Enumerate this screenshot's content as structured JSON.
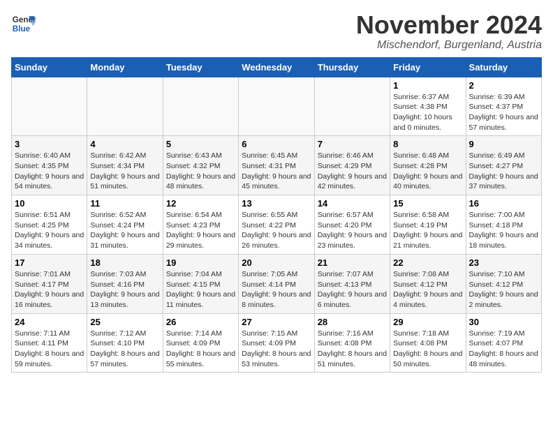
{
  "header": {
    "logo_line1": "General",
    "logo_line2": "Blue",
    "main_title": "November 2024",
    "subtitle": "Mischendorf, Burgenland, Austria"
  },
  "days_of_week": [
    "Sunday",
    "Monday",
    "Tuesday",
    "Wednesday",
    "Thursday",
    "Friday",
    "Saturday"
  ],
  "weeks": [
    [
      {
        "day": "",
        "detail": ""
      },
      {
        "day": "",
        "detail": ""
      },
      {
        "day": "",
        "detail": ""
      },
      {
        "day": "",
        "detail": ""
      },
      {
        "day": "",
        "detail": ""
      },
      {
        "day": "1",
        "detail": "Sunrise: 6:37 AM\nSunset: 4:38 PM\nDaylight: 10 hours and 0 minutes."
      },
      {
        "day": "2",
        "detail": "Sunrise: 6:39 AM\nSunset: 4:37 PM\nDaylight: 9 hours and 57 minutes."
      }
    ],
    [
      {
        "day": "3",
        "detail": "Sunrise: 6:40 AM\nSunset: 4:35 PM\nDaylight: 9 hours and 54 minutes."
      },
      {
        "day": "4",
        "detail": "Sunrise: 6:42 AM\nSunset: 4:34 PM\nDaylight: 9 hours and 51 minutes."
      },
      {
        "day": "5",
        "detail": "Sunrise: 6:43 AM\nSunset: 4:32 PM\nDaylight: 9 hours and 48 minutes."
      },
      {
        "day": "6",
        "detail": "Sunrise: 6:45 AM\nSunset: 4:31 PM\nDaylight: 9 hours and 45 minutes."
      },
      {
        "day": "7",
        "detail": "Sunrise: 6:46 AM\nSunset: 4:29 PM\nDaylight: 9 hours and 42 minutes."
      },
      {
        "day": "8",
        "detail": "Sunrise: 6:48 AM\nSunset: 4:28 PM\nDaylight: 9 hours and 40 minutes."
      },
      {
        "day": "9",
        "detail": "Sunrise: 6:49 AM\nSunset: 4:27 PM\nDaylight: 9 hours and 37 minutes."
      }
    ],
    [
      {
        "day": "10",
        "detail": "Sunrise: 6:51 AM\nSunset: 4:25 PM\nDaylight: 9 hours and 34 minutes."
      },
      {
        "day": "11",
        "detail": "Sunrise: 6:52 AM\nSunset: 4:24 PM\nDaylight: 9 hours and 31 minutes."
      },
      {
        "day": "12",
        "detail": "Sunrise: 6:54 AM\nSunset: 4:23 PM\nDaylight: 9 hours and 29 minutes."
      },
      {
        "day": "13",
        "detail": "Sunrise: 6:55 AM\nSunset: 4:22 PM\nDaylight: 9 hours and 26 minutes."
      },
      {
        "day": "14",
        "detail": "Sunrise: 6:57 AM\nSunset: 4:20 PM\nDaylight: 9 hours and 23 minutes."
      },
      {
        "day": "15",
        "detail": "Sunrise: 6:58 AM\nSunset: 4:19 PM\nDaylight: 9 hours and 21 minutes."
      },
      {
        "day": "16",
        "detail": "Sunrise: 7:00 AM\nSunset: 4:18 PM\nDaylight: 9 hours and 18 minutes."
      }
    ],
    [
      {
        "day": "17",
        "detail": "Sunrise: 7:01 AM\nSunset: 4:17 PM\nDaylight: 9 hours and 16 minutes."
      },
      {
        "day": "18",
        "detail": "Sunrise: 7:03 AM\nSunset: 4:16 PM\nDaylight: 9 hours and 13 minutes."
      },
      {
        "day": "19",
        "detail": "Sunrise: 7:04 AM\nSunset: 4:15 PM\nDaylight: 9 hours and 11 minutes."
      },
      {
        "day": "20",
        "detail": "Sunrise: 7:05 AM\nSunset: 4:14 PM\nDaylight: 9 hours and 8 minutes."
      },
      {
        "day": "21",
        "detail": "Sunrise: 7:07 AM\nSunset: 4:13 PM\nDaylight: 9 hours and 6 minutes."
      },
      {
        "day": "22",
        "detail": "Sunrise: 7:08 AM\nSunset: 4:12 PM\nDaylight: 9 hours and 4 minutes."
      },
      {
        "day": "23",
        "detail": "Sunrise: 7:10 AM\nSunset: 4:12 PM\nDaylight: 9 hours and 2 minutes."
      }
    ],
    [
      {
        "day": "24",
        "detail": "Sunrise: 7:11 AM\nSunset: 4:11 PM\nDaylight: 8 hours and 59 minutes."
      },
      {
        "day": "25",
        "detail": "Sunrise: 7:12 AM\nSunset: 4:10 PM\nDaylight: 8 hours and 57 minutes."
      },
      {
        "day": "26",
        "detail": "Sunrise: 7:14 AM\nSunset: 4:09 PM\nDaylight: 8 hours and 55 minutes."
      },
      {
        "day": "27",
        "detail": "Sunrise: 7:15 AM\nSunset: 4:09 PM\nDaylight: 8 hours and 53 minutes."
      },
      {
        "day": "28",
        "detail": "Sunrise: 7:16 AM\nSunset: 4:08 PM\nDaylight: 8 hours and 51 minutes."
      },
      {
        "day": "29",
        "detail": "Sunrise: 7:18 AM\nSunset: 4:08 PM\nDaylight: 8 hours and 50 minutes."
      },
      {
        "day": "30",
        "detail": "Sunrise: 7:19 AM\nSunset: 4:07 PM\nDaylight: 8 hours and 48 minutes."
      }
    ]
  ]
}
